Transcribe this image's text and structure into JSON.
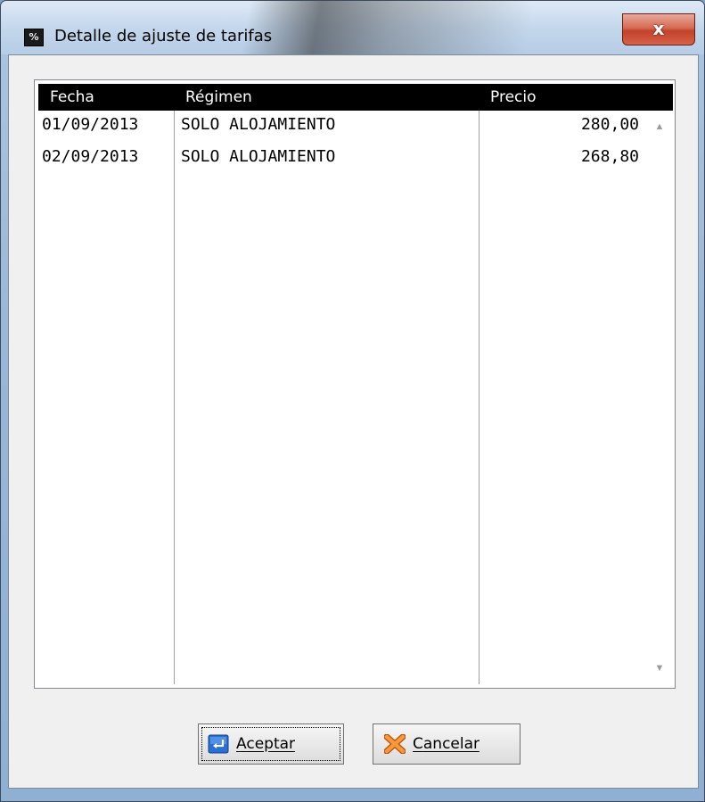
{
  "window": {
    "title": "Detalle de ajuste de tarifas",
    "close_label": "x",
    "app_icon_text": "%"
  },
  "grid": {
    "columns": [
      "Fecha",
      "Régimen",
      "Precio"
    ],
    "rows": [
      {
        "fecha": "01/09/2013",
        "regimen": "SOLO ALOJAMIENTO",
        "precio": "280,00"
      },
      {
        "fecha": "02/09/2013",
        "regimen": "SOLO ALOJAMIENTO",
        "precio": "268,80"
      }
    ],
    "scroll_up": "▲",
    "scroll_down": "▼"
  },
  "buttons": {
    "accept": {
      "mnemonic": "A",
      "rest": "ceptar"
    },
    "cancel": {
      "mnemonic": "C",
      "rest": "ancelar"
    }
  },
  "colors": {
    "header_bg": "#000000",
    "accept_icon": "#2a6fd6",
    "cancel_icon": "#f07a1a"
  }
}
